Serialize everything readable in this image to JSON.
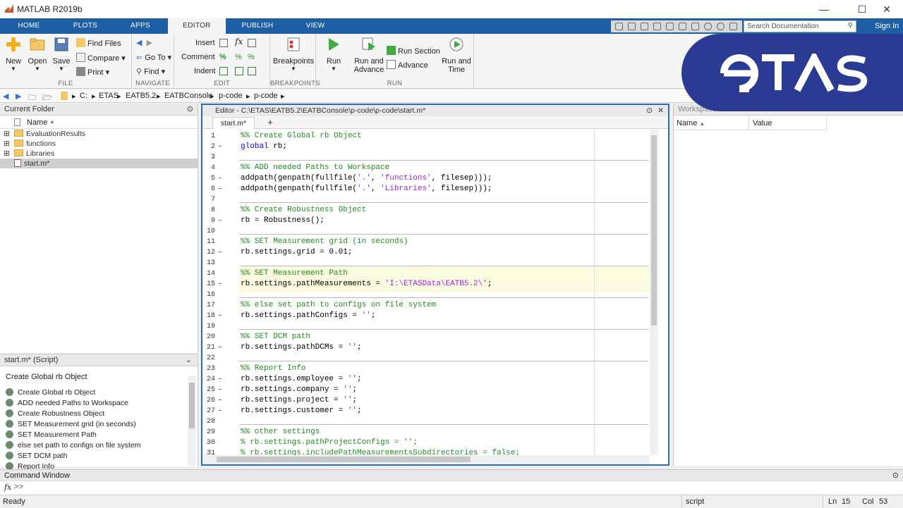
{
  "app": {
    "title": "MATLAB R2019b"
  },
  "ribbon_tabs": [
    "HOME",
    "PLOTS",
    "APPS",
    "EDITOR",
    "PUBLISH",
    "VIEW"
  ],
  "search": {
    "placeholder": "Search Documentation"
  },
  "signin_label": "Sign In",
  "toolstrip": {
    "file": {
      "name": "FILE",
      "new": "New",
      "open": "Open",
      "save": "Save",
      "find_files": "Find Files",
      "compare": "Compare",
      "print": "Print"
    },
    "navigate": {
      "name": "NAVIGATE",
      "goto": "Go To",
      "find": "Find"
    },
    "edit": {
      "name": "EDIT",
      "insert": "Insert",
      "comment": "Comment",
      "indent": "Indent"
    },
    "breakpoints": {
      "name": "BREAKPOINTS",
      "label": "Breakpoints"
    },
    "run": {
      "name": "RUN",
      "run": "Run",
      "run_and_advance_1": "Run and",
      "run_and_advance_2": "Advance",
      "run_section": "Run Section",
      "advance": "Advance",
      "run_and_time_1": "Run and",
      "run_and_time_2": "Time"
    }
  },
  "address": {
    "parts": [
      "C:",
      "ETAS",
      "EATB5.2",
      "EATBConsole",
      "p-code",
      "p-code"
    ]
  },
  "current_folder": {
    "title": "Current Folder",
    "col_name": "Name",
    "items": [
      {
        "name": "EvaluationResults",
        "type": "folder"
      },
      {
        "name": "functions",
        "type": "folder"
      },
      {
        "name": "Libraries",
        "type": "folder"
      },
      {
        "name": "start.m*",
        "type": "file"
      }
    ]
  },
  "details": {
    "title": "start.m* (Script)",
    "heading": "Create Global rb Object",
    "items": [
      "Create Global rb Object",
      "ADD needed Paths to Workspace",
      "Create Robustness Object",
      "SET Measurement grid (in seconds)",
      "SET Measurement Path",
      "else set path to configs on file system",
      "SET DCM path",
      "Report Info"
    ]
  },
  "editor": {
    "title": "Editor - C:\\ETAS\\EATB5.2\\EATBConsole\\p-code\\p-code\\start.m*",
    "tab": "start.m*",
    "add_tab": "+",
    "lines": [
      {
        "n": "1",
        "fold": "",
        "t": [
          {
            "c": "comment",
            "s": "%% Create Global rb Object"
          }
        ]
      },
      {
        "n": "2",
        "fold": "–",
        "t": [
          {
            "c": "kw",
            "s": "global"
          },
          {
            "c": "",
            "s": " rb;"
          }
        ]
      },
      {
        "n": "3",
        "fold": "",
        "t": []
      },
      {
        "n": "4",
        "fold": "",
        "t": [
          {
            "c": "comment",
            "s": "%% ADD needed Paths to Workspace"
          }
        ]
      },
      {
        "n": "5",
        "fold": "–",
        "t": [
          {
            "c": "",
            "s": "addpath(genpath(fullfile("
          },
          {
            "c": "str",
            "s": "'.'"
          },
          {
            "c": "",
            "s": ", "
          },
          {
            "c": "str",
            "s": "'functions'"
          },
          {
            "c": "",
            "s": ", filesep)));"
          }
        ]
      },
      {
        "n": "6",
        "fold": "–",
        "t": [
          {
            "c": "",
            "s": "addpath(genpath(fullfile("
          },
          {
            "c": "str",
            "s": "'.'"
          },
          {
            "c": "",
            "s": ", "
          },
          {
            "c": "str",
            "s": "'Libraries'"
          },
          {
            "c": "",
            "s": ", filesep)));"
          }
        ]
      },
      {
        "n": "7",
        "fold": "",
        "t": []
      },
      {
        "n": "8",
        "fold": "",
        "t": [
          {
            "c": "comment",
            "s": "%% Create Robustness Object"
          }
        ]
      },
      {
        "n": "9",
        "fold": "–",
        "t": [
          {
            "c": "",
            "s": "rb = Robustness();"
          }
        ]
      },
      {
        "n": "10",
        "fold": "",
        "t": []
      },
      {
        "n": "11",
        "fold": "",
        "t": [
          {
            "c": "comment",
            "s": "%% SET Measurement grid (in seconds)"
          }
        ]
      },
      {
        "n": "12",
        "fold": "–",
        "t": [
          {
            "c": "",
            "s": "rb.settings.grid = 0.01;"
          }
        ]
      },
      {
        "n": "13",
        "fold": "",
        "t": []
      },
      {
        "n": "14",
        "fold": "",
        "t": [
          {
            "c": "comment",
            "s": "%% SET Measurement Path"
          }
        ]
      },
      {
        "n": "15",
        "fold": "–",
        "t": [
          {
            "c": "",
            "s": "rb.settings.pathMeasurements = "
          },
          {
            "c": "str",
            "s": "'I:\\ETASData\\EATB5.2\\'"
          },
          {
            "c": "",
            "s": ";"
          }
        ]
      },
      {
        "n": "16",
        "fold": "",
        "t": []
      },
      {
        "n": "17",
        "fold": "",
        "t": [
          {
            "c": "comment",
            "s": "%% else set path to configs on file system"
          }
        ]
      },
      {
        "n": "18",
        "fold": "–",
        "t": [
          {
            "c": "",
            "s": "rb.settings.pathConfigs = "
          },
          {
            "c": "str",
            "s": "''"
          },
          {
            "c": "",
            "s": ";"
          }
        ]
      },
      {
        "n": "19",
        "fold": "",
        "t": []
      },
      {
        "n": "20",
        "fold": "",
        "t": [
          {
            "c": "comment",
            "s": "%% SET DCM path"
          }
        ]
      },
      {
        "n": "21",
        "fold": "–",
        "t": [
          {
            "c": "",
            "s": "rb.settings.pathDCMs = "
          },
          {
            "c": "str",
            "s": "''"
          },
          {
            "c": "",
            "s": ";"
          }
        ]
      },
      {
        "n": "22",
        "fold": "",
        "t": []
      },
      {
        "n": "23",
        "fold": "",
        "t": [
          {
            "c": "comment",
            "s": "%% Report Info"
          }
        ]
      },
      {
        "n": "24",
        "fold": "–",
        "t": [
          {
            "c": "",
            "s": "rb.settings.employee = "
          },
          {
            "c": "str",
            "s": "''"
          },
          {
            "c": "",
            "s": ";"
          }
        ]
      },
      {
        "n": "25",
        "fold": "–",
        "t": [
          {
            "c": "",
            "s": "rb.settings.company = "
          },
          {
            "c": "str",
            "s": "''"
          },
          {
            "c": "",
            "s": ";"
          }
        ]
      },
      {
        "n": "26",
        "fold": "–",
        "t": [
          {
            "c": "",
            "s": "rb.settings.project = "
          },
          {
            "c": "str",
            "s": "''"
          },
          {
            "c": "",
            "s": ";"
          }
        ]
      },
      {
        "n": "27",
        "fold": "–",
        "t": [
          {
            "c": "",
            "s": "rb.settings.customer = "
          },
          {
            "c": "str",
            "s": "''"
          },
          {
            "c": "",
            "s": ";"
          }
        ]
      },
      {
        "n": "28",
        "fold": "",
        "t": []
      },
      {
        "n": "29",
        "fold": "",
        "t": [
          {
            "c": "comment",
            "s": "%% other settings"
          }
        ]
      },
      {
        "n": "30",
        "fold": "",
        "t": [
          {
            "c": "comment",
            "s": "% rb.settings.pathProjectConfigs = '';"
          }
        ]
      },
      {
        "n": "31",
        "fold": "",
        "t": [
          {
            "c": "comment",
            "s": "% rb.settings.includePathMeasurementsSubdirectories = false;"
          }
        ]
      }
    ]
  },
  "workspace": {
    "title": "Workspace",
    "col_name": "Name",
    "col_value": "Value"
  },
  "command_window": {
    "title": "Command Window",
    "fx": "fx",
    "prompt": ">>"
  },
  "status": {
    "state": "Ready",
    "type": "script",
    "ln_label": "Ln",
    "ln": "15",
    "col_label": "Col",
    "col": "53"
  },
  "branding": {
    "logo_text": "eTAS"
  },
  "colors": {
    "tab_blue": "#1e5fa5",
    "comment": "#228b22",
    "string": "#a020f0",
    "keyword": "#0000ff",
    "etas_blue": "#2b3a93",
    "current_cell": "#fbfbe0"
  }
}
